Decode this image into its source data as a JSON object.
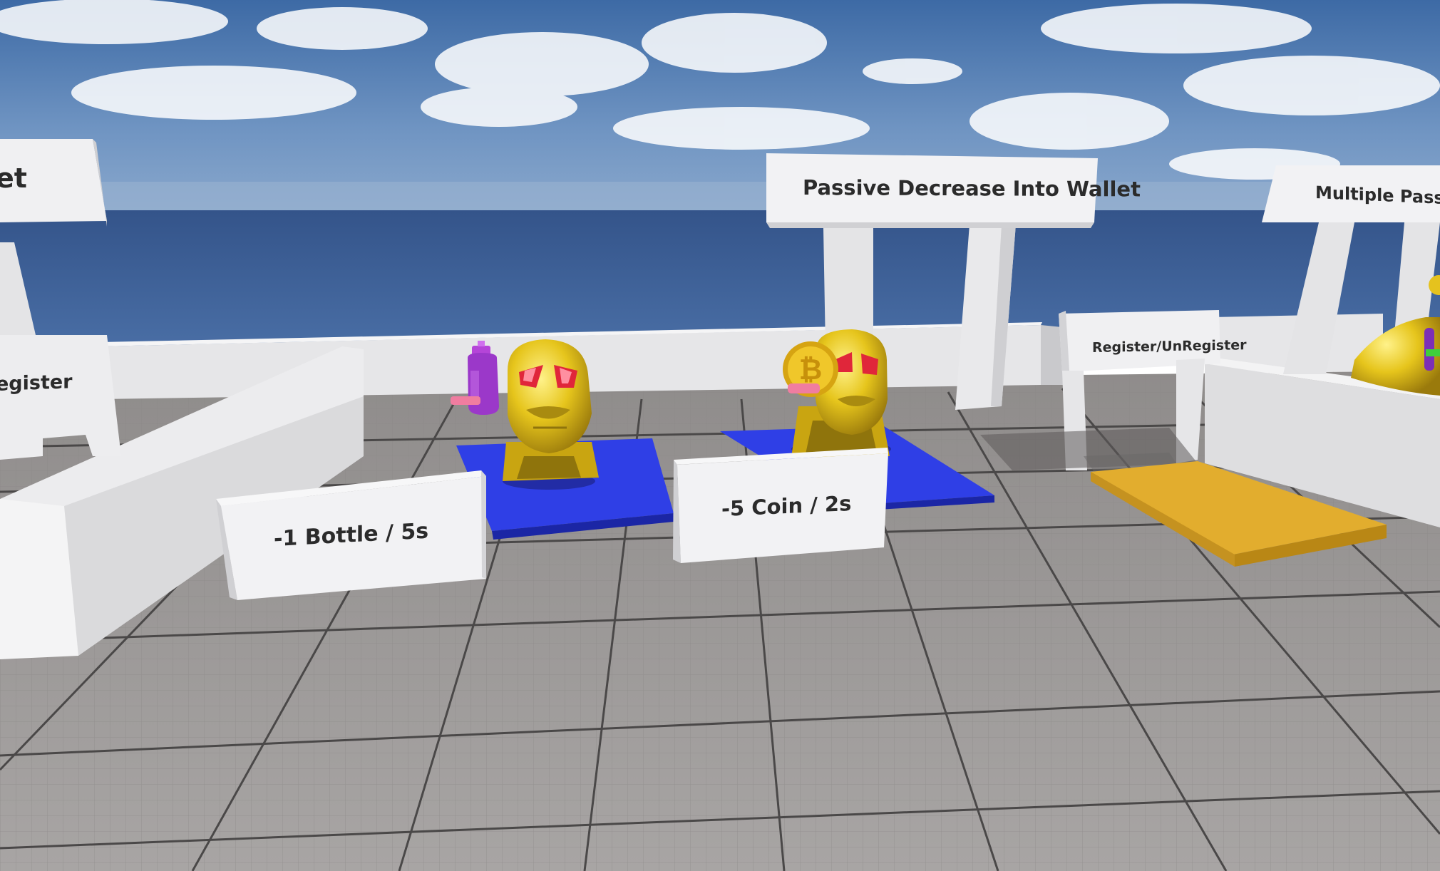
{
  "scene": {
    "description_label": "",
    "signs": {
      "main_title": "Passive Decrease Into Wallet",
      "right_title": "Multiple Passive",
      "left_title": "et",
      "left_register": "egister",
      "right_register": "Register/UnRegister",
      "bottle_rate": "-1 Bottle / 5s",
      "coin_rate": "-5 Coin / 2s"
    },
    "colors": {
      "sky_top": "#3f6ea8",
      "sea": "#3b5f96",
      "floor": "#9a9796",
      "wall": "#e8e8ea",
      "pad_blue": "#2f3fe6",
      "pad_gold": "#d9a32a",
      "statue_gold": "#e5c21e",
      "gem_red": "#e0263a",
      "bottle_purple": "#9b38c9"
    },
    "icons": [
      "bottle-icon",
      "bitcoin-coin-icon",
      "gold-head-statue-icon"
    ]
  }
}
